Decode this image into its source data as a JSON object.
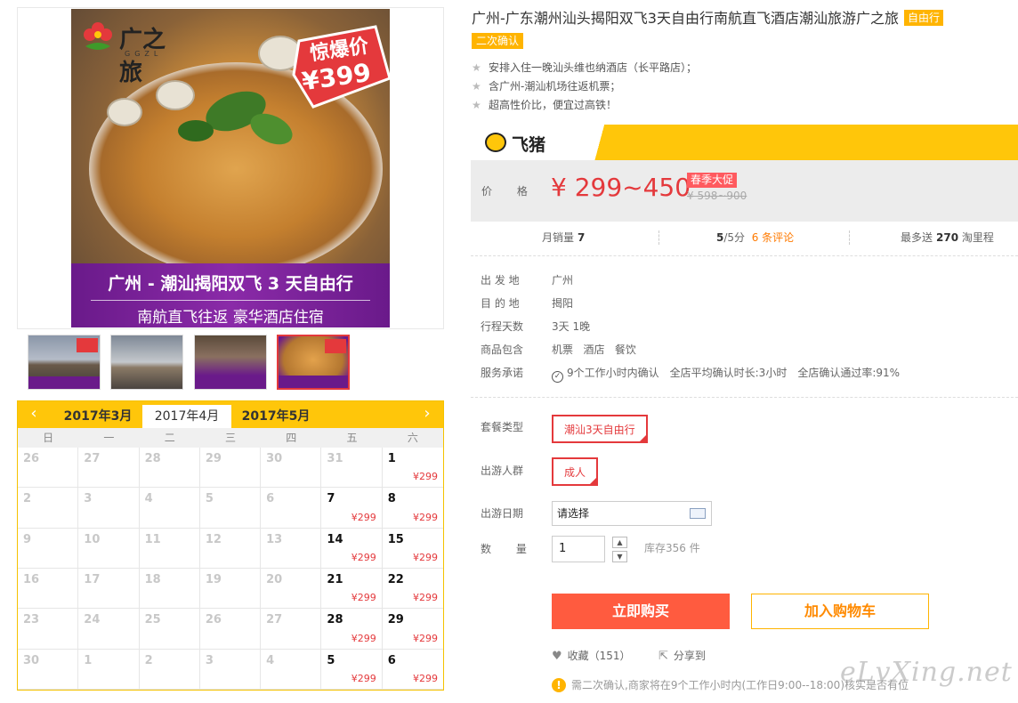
{
  "gallery": {
    "logo_text": "广之旅",
    "logo_sub": "GGZL",
    "promo_line1": "惊爆价",
    "promo_line2": "¥399",
    "banner_line1": "广州 - 潮汕揭阳双飞 3 天自由行",
    "banner_line2": "南航直飞往返 豪华酒店住宿"
  },
  "calendar": {
    "prev_icon": "‹",
    "next_icon": "›",
    "months": [
      "2017年3月",
      "2017年4月",
      "2017年5月"
    ],
    "weekdays": [
      "日",
      "一",
      "二",
      "三",
      "四",
      "五",
      "六"
    ],
    "cells": [
      {
        "day": "26",
        "price": ""
      },
      {
        "day": "27",
        "price": ""
      },
      {
        "day": "28",
        "price": ""
      },
      {
        "day": "29",
        "price": ""
      },
      {
        "day": "30",
        "price": ""
      },
      {
        "day": "31",
        "price": ""
      },
      {
        "day": "1",
        "price": "¥299"
      },
      {
        "day": "2",
        "price": ""
      },
      {
        "day": "3",
        "price": ""
      },
      {
        "day": "4",
        "price": ""
      },
      {
        "day": "5",
        "price": ""
      },
      {
        "day": "6",
        "price": ""
      },
      {
        "day": "7",
        "price": "¥299"
      },
      {
        "day": "8",
        "price": "¥299"
      },
      {
        "day": "9",
        "price": ""
      },
      {
        "day": "10",
        "price": ""
      },
      {
        "day": "11",
        "price": ""
      },
      {
        "day": "12",
        "price": ""
      },
      {
        "day": "13",
        "price": ""
      },
      {
        "day": "14",
        "price": "¥299"
      },
      {
        "day": "15",
        "price": "¥299"
      },
      {
        "day": "16",
        "price": ""
      },
      {
        "day": "17",
        "price": ""
      },
      {
        "day": "18",
        "price": ""
      },
      {
        "day": "19",
        "price": ""
      },
      {
        "day": "20",
        "price": ""
      },
      {
        "day": "21",
        "price": "¥299"
      },
      {
        "day": "22",
        "price": "¥299"
      },
      {
        "day": "23",
        "price": ""
      },
      {
        "day": "24",
        "price": ""
      },
      {
        "day": "25",
        "price": ""
      },
      {
        "day": "26",
        "price": ""
      },
      {
        "day": "27",
        "price": ""
      },
      {
        "day": "28",
        "price": "¥299"
      },
      {
        "day": "29",
        "price": "¥299"
      },
      {
        "day": "30",
        "price": ""
      },
      {
        "day": "1",
        "price": ""
      },
      {
        "day": "2",
        "price": ""
      },
      {
        "day": "3",
        "price": ""
      },
      {
        "day": "4",
        "price": ""
      },
      {
        "day": "5",
        "price": "¥299"
      },
      {
        "day": "6",
        "price": "¥299"
      }
    ]
  },
  "product": {
    "title": "广州-广东潮州汕头揭阳双飞3天自由行南航直飞酒店潮汕旅游广之旅",
    "tag_free": "自由行",
    "tag_confirm": "二次确认",
    "features": [
      "安排入住一晚汕头维也纳酒店（长平路店）；",
      "含广州-潮汕机场往返机票；",
      "超高性价比，便宜过高铁！"
    ]
  },
  "price": {
    "brand": "飞猪",
    "label": "价 格",
    "main": "¥ 299~450",
    "promo_tag": "春季大促",
    "old": "¥ 598~900"
  },
  "stats": {
    "sales_label": "月销量",
    "sales_value": "7",
    "score": "5",
    "score_suffix": "/5分",
    "reviews": "6 条评论",
    "mileage_label": "最多送",
    "mileage_value": "270",
    "mileage_suffix": "淘里程"
  },
  "details": {
    "rows": [
      {
        "label": "出 发 地",
        "value": "广州"
      },
      {
        "label": "目 的 地",
        "value": "揭阳"
      },
      {
        "label": "行程天数",
        "value": "3天 1晚"
      },
      {
        "label": "商品包含",
        "value": "机票   酒店   餐饮"
      }
    ],
    "service_label": "服务承诺",
    "service_items": [
      "9个工作小时内确认",
      "全店平均确认时长:3小时",
      "全店确认通过率:91%"
    ]
  },
  "options": {
    "package_label": "套餐类型",
    "package_value": "潮汕3天自由行",
    "crowd_label": "出游人群",
    "crowd_value": "成人",
    "date_label": "出游日期",
    "date_placeholder": "请选择",
    "qty_label": "数 量",
    "qty_value": "1",
    "qty_up": "▲",
    "qty_down": "▼",
    "stock": "库存356 件"
  },
  "actions": {
    "buy": "立即购买",
    "cart": "加入购物车",
    "favorite": "收藏（151）",
    "share": "分享到",
    "notice": "需二次确认,商家将在9个工作小时内(工作日9:00--18:00)核实是否有位"
  },
  "watermark": "eLvXing.net",
  "colors": {
    "accent": "#e4393c",
    "yellow": "#ffc60a",
    "buy": "#ff5b3f"
  }
}
